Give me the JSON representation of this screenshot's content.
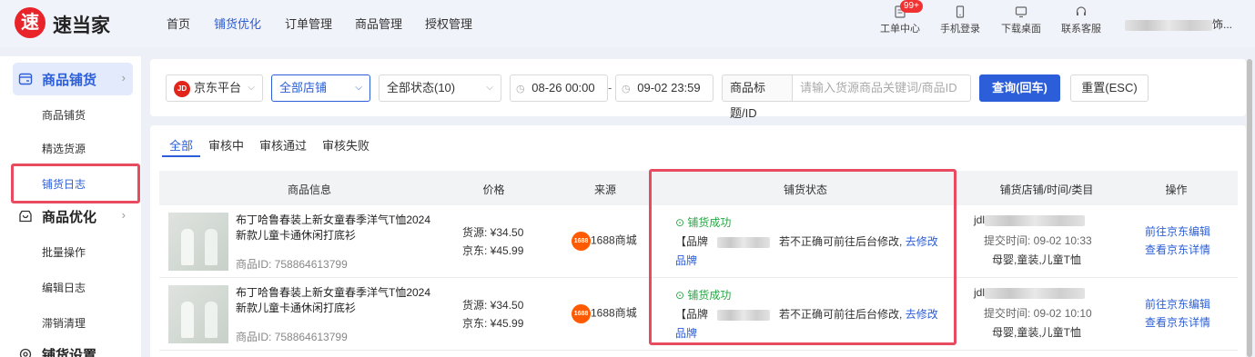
{
  "app": {
    "logo_char": "速",
    "name": "速当家"
  },
  "nav": [
    {
      "label": "首页"
    },
    {
      "label": "铺货优化"
    },
    {
      "label": "订单管理"
    },
    {
      "label": "商品管理"
    },
    {
      "label": "授权管理"
    }
  ],
  "tools": {
    "badge": "99+",
    "items": [
      {
        "label": "工单中心",
        "icon": "ticket-icon"
      },
      {
        "label": "手机登录",
        "icon": "phone-icon"
      },
      {
        "label": "下载桌面",
        "icon": "monitor-icon"
      },
      {
        "label": "联系客服",
        "icon": "headset-icon"
      }
    ]
  },
  "user": {
    "suffix": "饰..."
  },
  "sidebar": {
    "group1": {
      "label": "商品铺货",
      "items": [
        "商品铺货",
        "精选货源",
        "铺货日志"
      ]
    },
    "group2": {
      "label": "商品优化",
      "items": [
        "批量操作",
        "编辑日志",
        "滞销清理"
      ]
    },
    "group3": {
      "label": "铺货设置"
    }
  },
  "filters": {
    "platform": "京东平台",
    "platform_badge": "JD",
    "shop": "全部店铺",
    "status": "全部状态(10)",
    "date_start": "08-26 00:00",
    "date_sep": "-",
    "date_end": "09-02 23:59",
    "search_type": "商品标题/ID",
    "search_placeholder": "请输入货源商品关键词/商品ID",
    "query_btn": "查询(回车)",
    "reset_btn": "重置(ESC)"
  },
  "tabs": [
    "全部",
    "审核中",
    "审核通过",
    "审核失败"
  ],
  "table": {
    "columns": [
      "商品信息",
      "价格",
      "来源",
      "铺货状态",
      "铺货店铺/时间/类目",
      "操作"
    ],
    "rows": [
      {
        "title": "布丁哈鲁春装上新女童春季洋气T恤2024新款儿童卡通休闲打底衫",
        "product_id": "商品ID: 758864613799",
        "source_price": "货源: ¥34.50",
        "jd_price": "京东: ¥45.99",
        "source_badge": "1688",
        "source": "1688商城",
        "status": "铺货成功",
        "msg_prefix": "【品牌",
        "msg_mid": "若不正确可前往后台修改,",
        "msg_link": "去修改品牌",
        "shop_prefix": "jdl",
        "time": "提交时间: 09-02 10:33",
        "category": "母婴,童装,儿童T恤",
        "op1": "前往京东编辑",
        "op2": "查看京东详情"
      },
      {
        "title": "布丁哈鲁春装上新女童春季洋气T恤2024新款儿童卡通休闲打底衫",
        "product_id": "商品ID: 758864613799",
        "source_price": "货源: ¥34.50",
        "jd_price": "京东: ¥45.99",
        "source_badge": "1688",
        "source": "1688商城",
        "status": "铺货成功",
        "msg_prefix": "【品牌",
        "msg_mid": "若不正确可前往后台修改,",
        "msg_link": "去修改品牌",
        "shop_prefix": "jdl",
        "time": "提交时间: 09-02 10:10",
        "category": "母婴,童装,儿童T恤",
        "op1": "前往京东编辑",
        "op2": "查看京东详情"
      }
    ]
  }
}
